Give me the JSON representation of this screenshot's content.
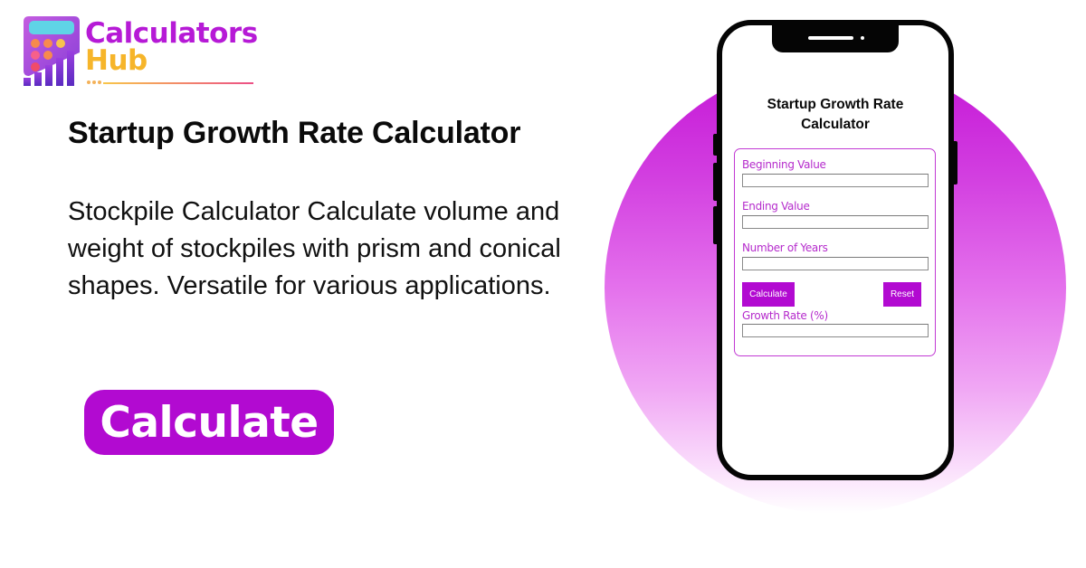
{
  "brand": {
    "name_line1": "Calculators",
    "name_line2": "Hub",
    "logo_icon": "calculator-chart-icon",
    "colors": {
      "purple": "#b61ad6",
      "gold": "#f6b52a"
    }
  },
  "hero": {
    "title": "Startup Growth Rate Calculator",
    "description": "Stockpile Calculator Calculate volume and weight of stockpiles with prism and conical shapes. Versatile for various applications.",
    "cta_label": "Calculate",
    "accent_color": "#b20ad1"
  },
  "phone": {
    "screen_title_line1": "Startup Growth Rate",
    "screen_title_line2": "Calculator",
    "form": {
      "fields": [
        {
          "label": "Beginning Value",
          "value": "",
          "placeholder": ""
        },
        {
          "label": "Ending Value",
          "value": "",
          "placeholder": ""
        },
        {
          "label": "Number of Years",
          "value": "",
          "placeholder": ""
        }
      ],
      "calculate_label": "Calculate",
      "reset_label": "Reset",
      "result": {
        "label": "Growth Rate (%)",
        "value": ""
      }
    }
  }
}
